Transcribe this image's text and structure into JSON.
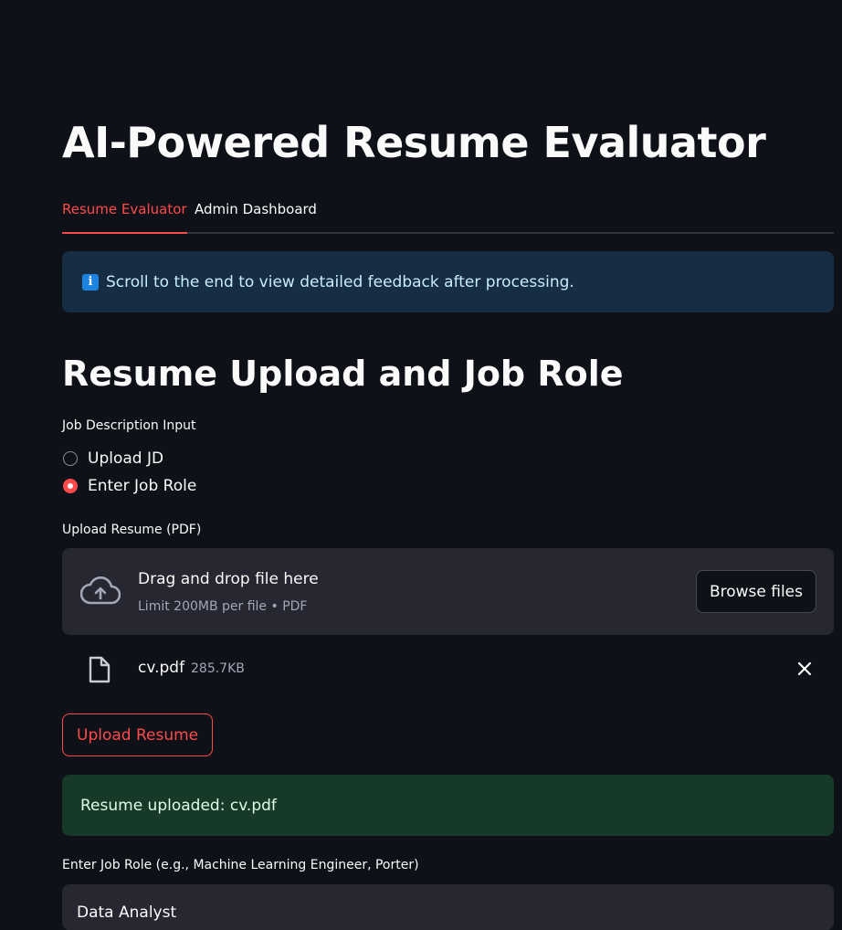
{
  "page": {
    "title": "AI-Powered Resume Evaluator"
  },
  "tabs": [
    {
      "label": "Resume Evaluator",
      "active": true
    },
    {
      "label": "Admin Dashboard",
      "active": false
    }
  ],
  "info_banner": {
    "icon": "info-icon",
    "text": "Scroll to the end to view detailed feedback after processing."
  },
  "section": {
    "heading": "Resume Upload and Job Role"
  },
  "jd_input": {
    "label": "Job Description Input",
    "options": [
      {
        "label": "Upload JD",
        "selected": false
      },
      {
        "label": "Enter Job Role",
        "selected": true
      }
    ]
  },
  "uploader": {
    "label": "Upload Resume (PDF)",
    "drop_text": "Drag and drop file here",
    "limit_text": "Limit 200MB per file • PDF",
    "browse_label": "Browse files",
    "icon": "cloud-upload-icon"
  },
  "uploaded_file": {
    "name": "cv.pdf",
    "size": "285.7KB",
    "icon": "file-icon",
    "remove_icon": "close-icon"
  },
  "upload_button": {
    "label": "Upload Resume"
  },
  "success_banner": {
    "text": "Resume uploaded: cv.pdf"
  },
  "job_role": {
    "label": "Enter Job Role (e.g., Machine Learning Engineer, Porter)",
    "value": "Data Analyst"
  },
  "colors": {
    "background": "#0e1117",
    "accent": "#ff4b4b",
    "info_bg": "#172d43",
    "success_bg": "#173928",
    "widget_bg": "#262730"
  }
}
